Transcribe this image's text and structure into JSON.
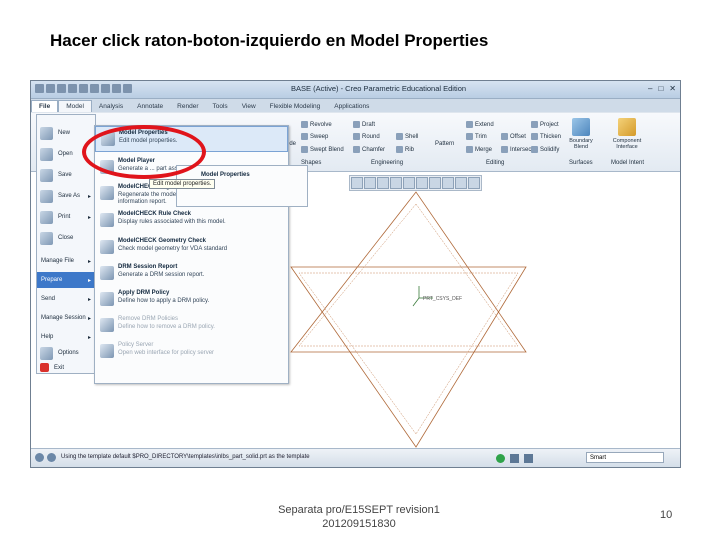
{
  "slide": {
    "title": "Hacer click raton-boton-izquierdo en Model Properties",
    "footer_line1": "Separata pro/E15SEPT revision1",
    "footer_line2": "201209151830",
    "page_number": "10"
  },
  "window": {
    "title": "BASE (Active) - Creo Parametric Educational Edition"
  },
  "tabs": [
    "File",
    "Model",
    "Analysis",
    "Annotate",
    "Render",
    "Tools",
    "View",
    "Flexible Modeling",
    "Applications"
  ],
  "ribbon": {
    "buttons": {
      "revolve": "Revolve",
      "sweep": "Sweep",
      "swept_blend": "Swept Blend",
      "draft": "Draft",
      "round": "Round",
      "chamfer": "Chamfer",
      "shell": "Shell",
      "rib": "Rib",
      "pattern": "Pattern",
      "extend": "Extend",
      "trim": "Trim",
      "offset": "Offset",
      "merge": "Merge",
      "intersect": "Intersect",
      "project": "Project",
      "thicken": "Thicken",
      "solidify": "Solidify",
      "boundary_blend": "Boundary Blend",
      "component_interface": "Component Interface",
      "ude": "ude"
    },
    "groups": [
      "Shapes",
      "Engineering",
      "Editing",
      "Surfaces",
      "Model Intent"
    ]
  },
  "file_menu": {
    "items": [
      "New",
      "Open",
      "Save",
      "Save As",
      "Print",
      "Close"
    ],
    "plain_items": [
      "Manage File",
      "Prepare",
      "Send",
      "Manage Session",
      "Help"
    ],
    "bottom_items": [
      "Options",
      "Exit"
    ]
  },
  "prepare_menu": {
    "items": [
      {
        "title": "Model Properties",
        "desc": "Edit model properties."
      },
      {
        "title": "Model Player",
        "desc": "Generate a ... part assembly."
      },
      {
        "title": "ModelCHECK Regenerate",
        "desc": "Regenerate the model and generate the Model Check information report."
      },
      {
        "title": "ModelCHECK Rule Check",
        "desc": "Display rules associated with this model."
      },
      {
        "title": "ModelCHECK Geometry Check",
        "desc": "Check model geometry for VDA standard"
      },
      {
        "title": "DRM Session Report",
        "desc": "Generate a DRM session report."
      },
      {
        "title": "Apply DRM Policy",
        "desc": "Define how to apply a DRM policy."
      },
      {
        "title": "Remove DRM Policies",
        "desc": "Define how to remove a DRM policy."
      },
      {
        "title": "Policy Server",
        "desc": "Open web interface for policy server"
      }
    ],
    "flyout_title": "Model Properties",
    "tooltip": "Edit model properties."
  },
  "canvas": {
    "csys_label": "PRT_CSYS_DEF"
  },
  "status": {
    "message": "Using the template default  $PRO_DIRECTORY\\templates\\inlbs_part_solid.prt as the template",
    "filter": "Smart"
  },
  "colors": {
    "highlight": "#e0141b",
    "sketch_line": "#b06a3a",
    "selection": "#3d78c9"
  }
}
